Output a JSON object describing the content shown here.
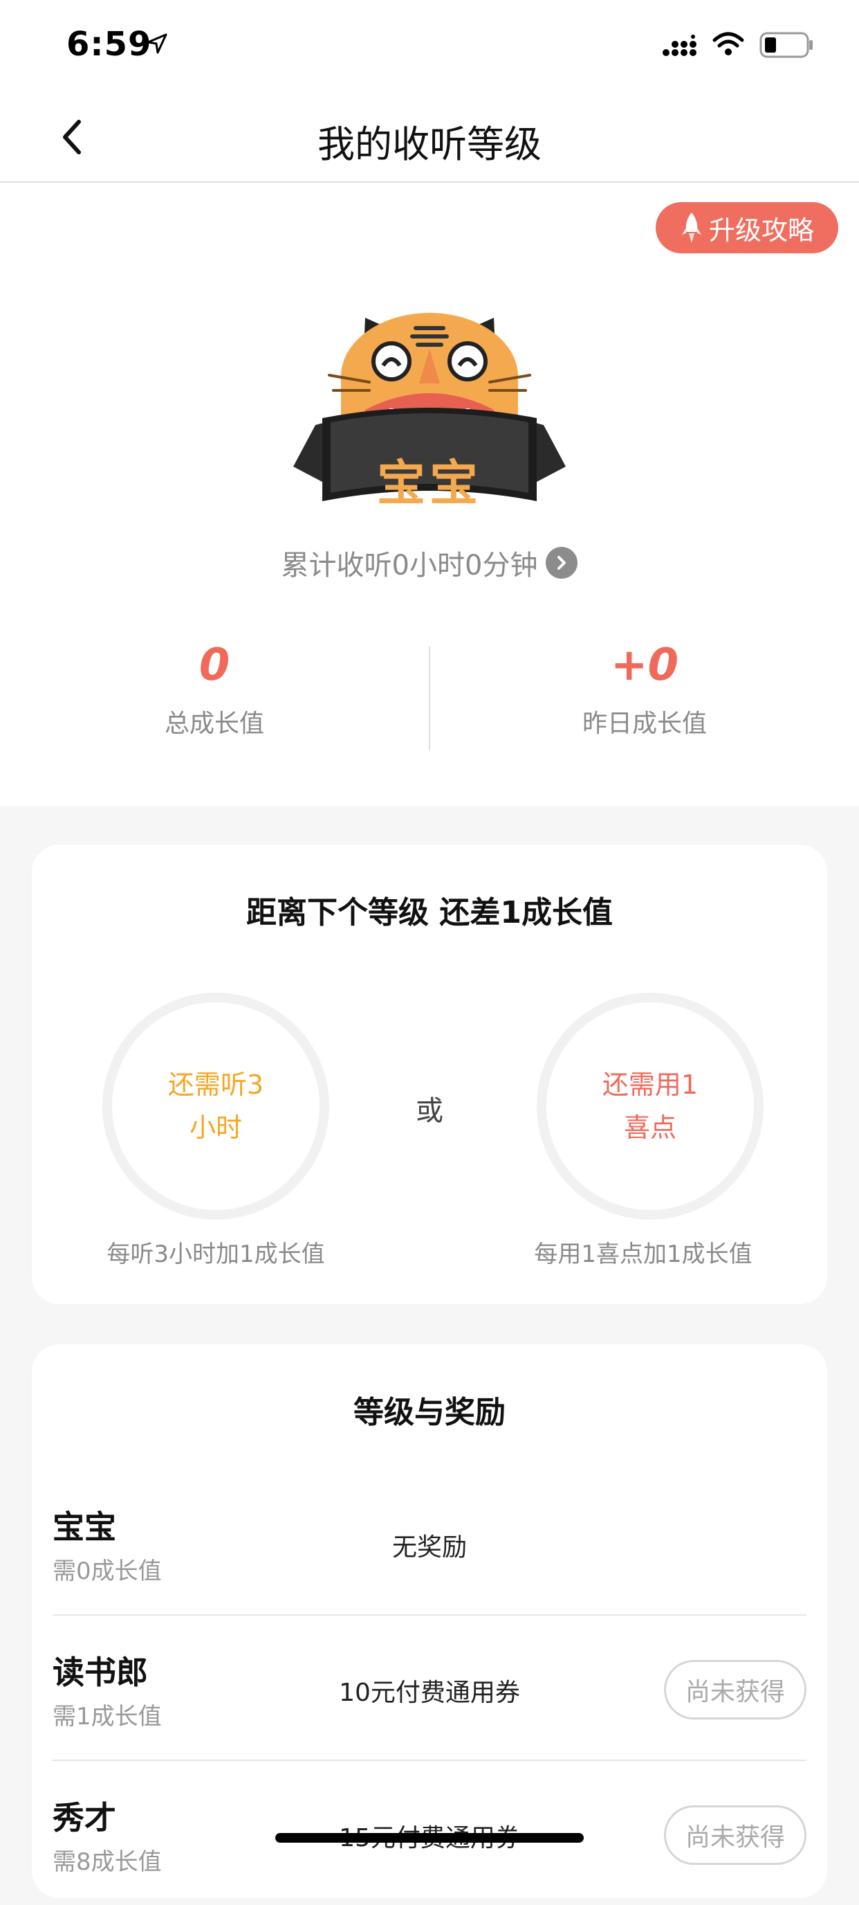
{
  "status_bar": {
    "time": "6:59"
  },
  "nav": {
    "title": "我的收听等级"
  },
  "hero": {
    "upgrade_label": "升级攻略",
    "badge_label": "宝宝",
    "listen_total": "累计收听0小时0分钟",
    "total_value": "0",
    "total_label": "总成长值",
    "yesterday_value": "+0",
    "yesterday_label": "昨日成长值"
  },
  "next_level": {
    "title": "距离下个等级 还差1成长值",
    "listen_line1": "还需听3",
    "listen_line2": "小时",
    "listen_note": "每听3小时加1成长值",
    "or_label": "或",
    "spend_line1": "还需用1",
    "spend_line2": "喜点",
    "spend_note": "每用1喜点加1成长值"
  },
  "rewards": {
    "title": "等级与奖励",
    "levels": [
      {
        "name": "宝宝",
        "requirement": "需0成长值",
        "reward": "无奖励",
        "status": ""
      },
      {
        "name": "读书郎",
        "requirement": "需1成长值",
        "reward": "10元付费通用券",
        "status": "尚未获得"
      },
      {
        "name": "秀才",
        "requirement": "需8成长值",
        "reward": "15元付费通用券",
        "status": "尚未获得"
      }
    ]
  },
  "colors": {
    "accent": "#f06e5f",
    "listen": "#f5a623",
    "spend": "#ef6a5b"
  }
}
